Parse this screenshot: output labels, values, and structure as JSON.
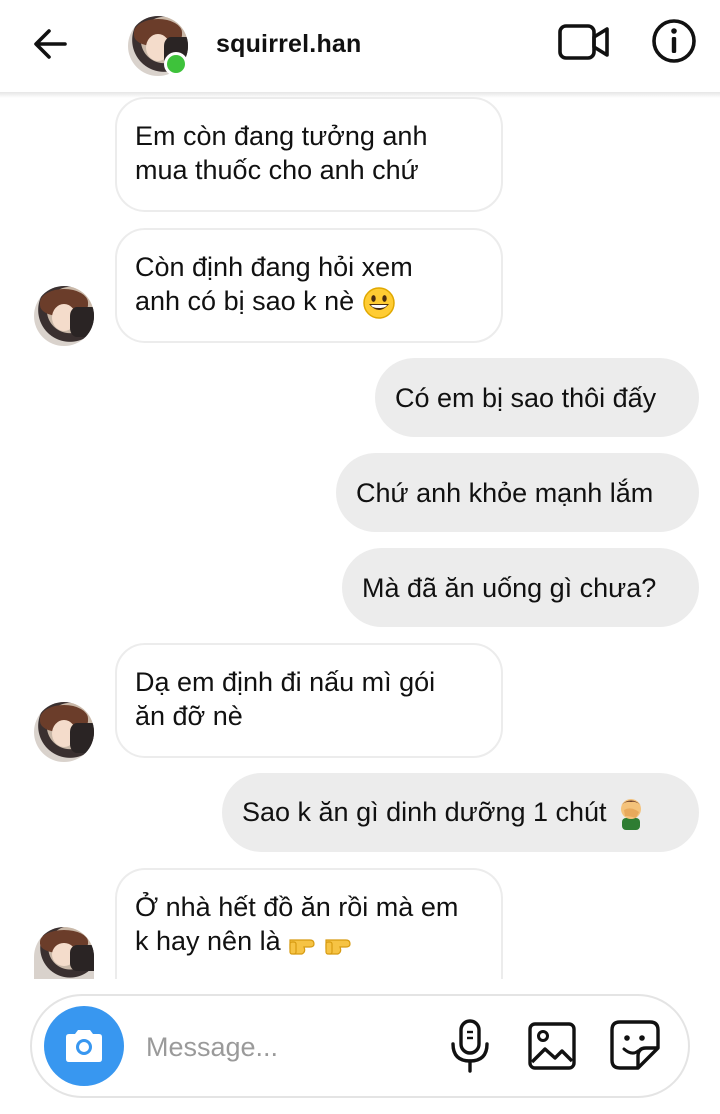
{
  "header": {
    "username": "squirrel.han",
    "icons": {
      "back": "arrow-left-icon",
      "video": "video-camera-icon",
      "info": "info-icon"
    },
    "presence_color": "#3ec23b"
  },
  "messages": [
    {
      "direction": "incoming",
      "lines": [
        "Em còn đang tưởng anh",
        "mua thuốc cho anh chứ"
      ]
    },
    {
      "direction": "incoming",
      "lines": [
        "Còn định đang hỏi xem",
        "anh có bị sao k nè"
      ],
      "emoji": "grinning-face-emoji"
    },
    {
      "direction": "outgoing",
      "text": "Có em bị sao thôi đấy"
    },
    {
      "direction": "outgoing",
      "text": "Chứ anh khỏe mạnh lắm"
    },
    {
      "direction": "outgoing",
      "text": "Mà đã ăn uống gì chưa?"
    },
    {
      "direction": "incoming",
      "lines": [
        "Dạ em định đi nấu mì gói",
        "ăn đỡ nè"
      ]
    },
    {
      "direction": "outgoing",
      "text": "Sao k ăn gì dinh dưỡng 1 chút",
      "emoji": "facepalm-emoji"
    },
    {
      "direction": "incoming",
      "lines": [
        "Ở nhà hết đồ ăn rồi mà em",
        "k hay nên là"
      ],
      "emoji": "pointing-fingers-emoji"
    }
  ],
  "composer": {
    "placeholder": "Message...",
    "icons": {
      "camera": "camera-icon",
      "mic": "microphone-icon",
      "gallery": "image-icon",
      "sticker": "sticker-icon"
    },
    "camera_color": "#3897f0"
  }
}
